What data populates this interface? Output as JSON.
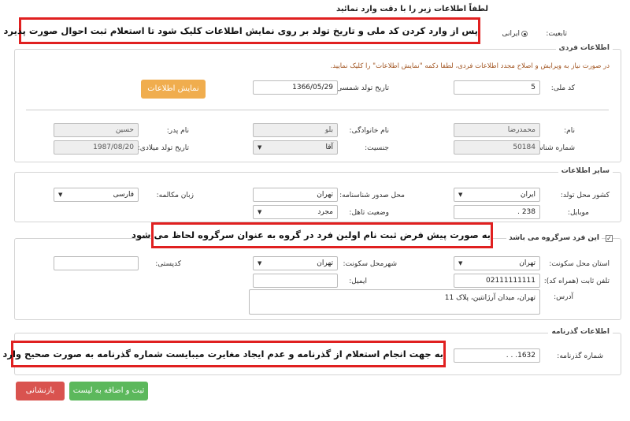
{
  "page": {
    "title": "لطفاً اطلاعات زیر را با دقت وارد نمائید"
  },
  "nationality": {
    "label": "تابعیت:",
    "option": "ایرانی"
  },
  "personal": {
    "legend": "اطلاعات فردی",
    "hint": "در صورت نیاز به ویرایش و اصلاح مجدد اطلاعات فردی، لطفا دکمه \"نمایش اطلاعات\" را کلیک نمایید.",
    "national_code_label": "کد ملی:",
    "national_code_value": "5",
    "birth_date_label": "تاریخ تولد شمسی:",
    "birth_date_value": "1366/05/29",
    "show_info_button": "نمایش اطلاعات",
    "first_name_label": "نام:",
    "first_name_value": "محمدرضا",
    "last_name_label": "نام خانوادگی:",
    "last_name_value": "بلو",
    "father_name_label": "نام پدر:",
    "father_name_value": "حسین",
    "id_number_label": "شماره شناسنامه:",
    "id_number_value": "50184",
    "gender_label": "جنسیت:",
    "gender_value": "آقا",
    "gregorian_birth_label": "تاریخ تولد میلادی:",
    "gregorian_birth_value": "1987/08/20"
  },
  "other": {
    "legend": "سایر اطلاعات",
    "birth_country_label": "کشور محل تولد:",
    "birth_country_value": "ایران",
    "id_issue_place_label": "محل صدور شناسنامه:",
    "id_issue_place_value": "تهران",
    "language_label": "زبان مکالمه:",
    "language_value": "فارسی",
    "mobile_label": "موبایل:",
    "mobile_value": "238 .",
    "marital_label": "وضعیت تاهل:",
    "marital_value": "مجرد"
  },
  "group_head": {
    "checkbox_label": "این فرد سرگروه می باشد",
    "province_label": "استان محل سکونت:",
    "province_value": "تهران",
    "city_label": "شهرمحل سکونت:",
    "city_value": "تهران",
    "postal_label": "کدپستی:",
    "postal_value": "",
    "phone_label": "تلفن ثابت (همراه کد):",
    "phone_value": "02111111111",
    "email_label": "ایمیل:",
    "email_value": "",
    "address_label": "آدرس:",
    "address_value": "تهران، میدان آرژانتین، پلاک 11"
  },
  "passport": {
    "legend": "اطلاعات گذرنامه",
    "number_label": "شماره گذرنامه:",
    "number_value": "1632. . ."
  },
  "buttons": {
    "submit": "ثبت و اضافه به لیست",
    "back": "بازنشانی"
  },
  "callouts": {
    "top": "پس از وارد کردن کد ملی و تاریخ تولد بر روی نمایش اطلاعات کلیک شود تا استعلام ثبت احوال صورت پذیرد",
    "middle": "به صورت پیش فرض ثبت نام اولین فرد در گروه به عنوان سرگروه لحاظ می شود",
    "bottom": "به جهت انجام استعلام از گذرنامه و عدم ایجاد مغایرت میبایست شماره گذرنامه به صورت صحیح وارد شود"
  },
  "colors": {
    "accent_orange": "#f0ad4e",
    "success_green": "#5cb85c",
    "danger_red": "#d9534f",
    "callout_border": "#e02020"
  }
}
